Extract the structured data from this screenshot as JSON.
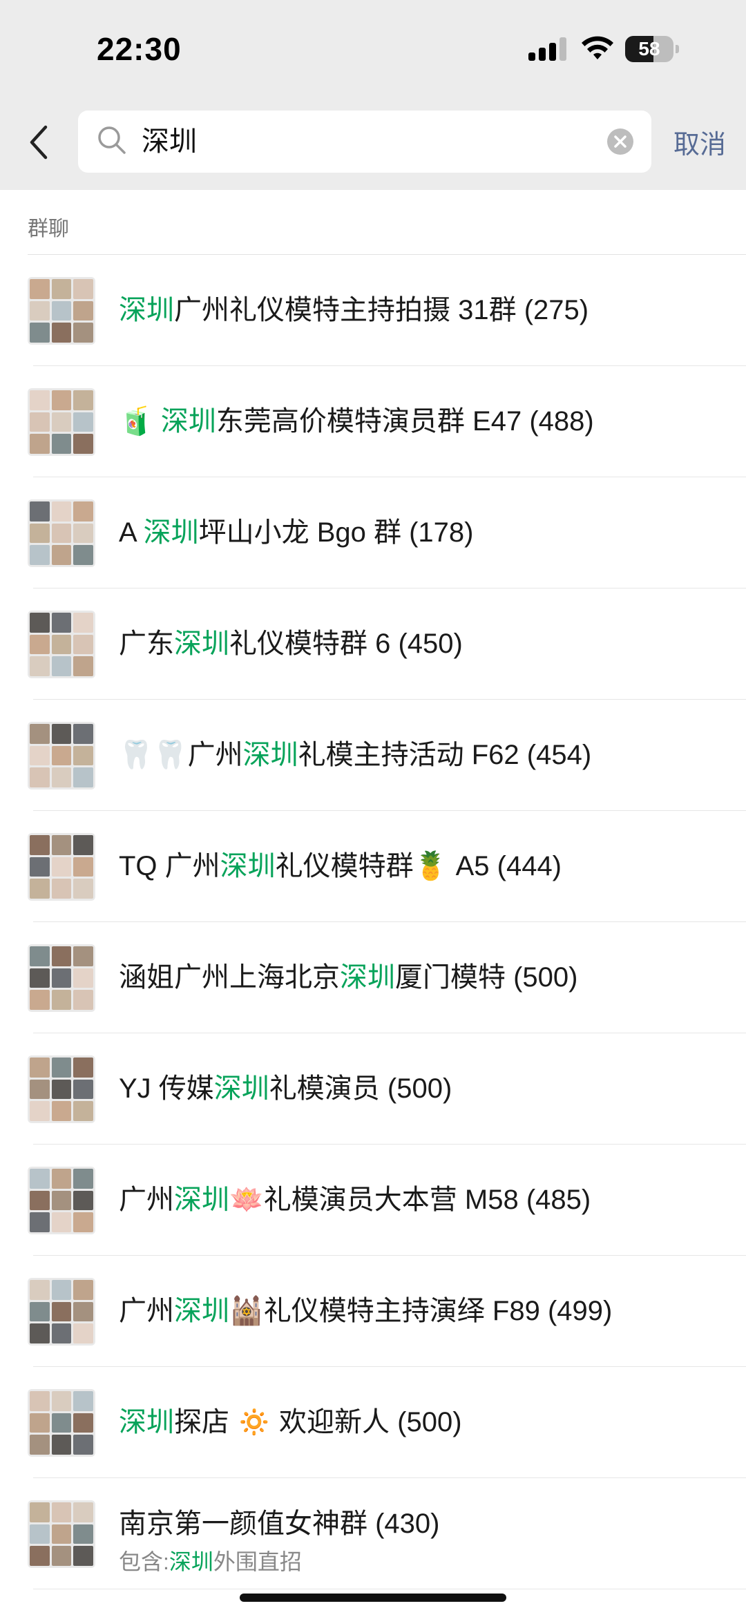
{
  "status_bar": {
    "time": "22:30",
    "battery": "58",
    "battery_level": 0.58
  },
  "search": {
    "query": "深圳",
    "cancel_label": "取消"
  },
  "section_header": "群聊",
  "highlight_color": "#07a35a",
  "results": [
    {
      "pre": "",
      "highlight": "深圳",
      "post": "广州礼仪模特主持拍摄 31群 (275)"
    },
    {
      "pre": "🧃 ",
      "highlight": "深圳",
      "post": "东莞高价模特演员群 E47 (488)"
    },
    {
      "pre": "A ",
      "highlight": "深圳",
      "post": "坪山小龙 Bgo 群 (178)"
    },
    {
      "pre": "广东",
      "highlight": "深圳",
      "post": "礼仪模特群 6 (450)"
    },
    {
      "pre": "🦷🦷广州",
      "highlight": "深圳",
      "post": "礼模主持活动 F62 (454)"
    },
    {
      "pre": "TQ 广州",
      "highlight": "深圳",
      "post": "礼仪模特群🍍 A5 (444)"
    },
    {
      "pre": "涵姐广州上海北京",
      "highlight": "深圳",
      "post": "厦门模特 (500)"
    },
    {
      "pre": "YJ 传媒",
      "highlight": "深圳",
      "post": "礼模演员 (500)"
    },
    {
      "pre": "广州",
      "highlight": "深圳",
      "post": "🪷礼模演员大本营 M58 (485)"
    },
    {
      "pre": "广州",
      "highlight": "深圳",
      "post": "🕍礼仪模特主持演绎 F89 (499)"
    },
    {
      "pre": "",
      "highlight": "深圳",
      "post": "探店 🔅 欢迎新人 (500)"
    },
    {
      "pre": "南京第一颜值女神群 (430)",
      "highlight": "",
      "post": "",
      "sub_pre": "包含:",
      "sub_highlight": "深圳",
      "sub_post": "外围直招"
    }
  ]
}
